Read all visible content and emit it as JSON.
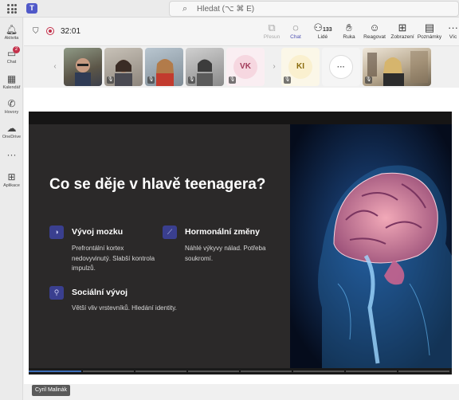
{
  "search": {
    "placeholder": "Hledat (⌥ ⌘ E)"
  },
  "rail": [
    {
      "label": "Aktivita",
      "icon": "bell-icon"
    },
    {
      "label": "Chat",
      "icon": "chat-icon",
      "badge": "2"
    },
    {
      "label": "Kalendář",
      "icon": "calendar-icon"
    },
    {
      "label": "Hovory",
      "icon": "phone-icon"
    },
    {
      "label": "OneDrive",
      "icon": "cloud-icon"
    },
    {
      "label": "Aplikace",
      "icon": "apps-add-icon"
    }
  ],
  "meeting": {
    "timer": "32:01",
    "tools": [
      {
        "label": "Přesun",
        "icon": "share-tray-icon",
        "state": "disabled"
      },
      {
        "label": "Chat",
        "icon": "chat-bubble-icon",
        "state": "active"
      },
      {
        "label": "Lidé",
        "icon": "people-icon",
        "count": "133"
      },
      {
        "label": "Ruka",
        "icon": "hand-icon"
      },
      {
        "label": "Reagovat",
        "icon": "smile-icon"
      },
      {
        "label": "Zobrazení",
        "icon": "grid-view-icon"
      },
      {
        "label": "Poznámky",
        "icon": "notes-icon"
      },
      {
        "label": "Víc",
        "icon": "more-icon"
      }
    ]
  },
  "participants": [
    {
      "initials": "VK",
      "color": "#f6d7e0",
      "text_color": "#a23b5a"
    },
    {
      "initials": "KI",
      "color": "#faf0cf",
      "text_color": "#8a6b0d"
    },
    {
      "initials": "···",
      "color": "#ffffff",
      "text_color": "#666666"
    }
  ],
  "slide": {
    "title": "Co se děje v hlavě teenagera?",
    "features": [
      {
        "heading": "Vývoj mozku",
        "body": "Prefrontální kortex nedovyvinutý. Slabší kontrola impulzů.",
        "icon": "brain-icon"
      },
      {
        "heading": "Hormonální změny",
        "body": "Náhlé výkyvy nálad. Potřeba soukromí.",
        "icon": "trend-chart-icon"
      },
      {
        "heading": "Sociální vývoj",
        "body": "Větší vliv vrstevníků. Hledání identity.",
        "icon": "person-icon"
      }
    ]
  },
  "presenter": {
    "name": "Cyril Malinák"
  },
  "colors": {
    "accent": "#4f52b2",
    "badge": "#c4314b",
    "slide_bg": "#2b2929",
    "icon_tile": "#3a3f8f"
  }
}
